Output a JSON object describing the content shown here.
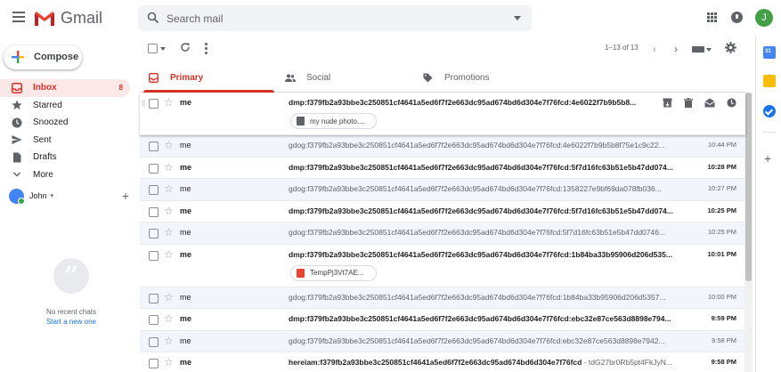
{
  "app": {
    "name": "Gmail",
    "user_initial": "J"
  },
  "search": {
    "placeholder": "Search mail"
  },
  "compose": {
    "label": "Compose"
  },
  "nav": [
    {
      "label": "Inbox",
      "count": "8",
      "icon": "inbox-icon"
    },
    {
      "label": "Starred",
      "count": "",
      "icon": "star-icon"
    },
    {
      "label": "Snoozed",
      "count": "",
      "icon": "clock-icon"
    },
    {
      "label": "Sent",
      "count": "",
      "icon": "send-icon"
    },
    {
      "label": "Drafts",
      "count": "",
      "icon": "draft-icon"
    },
    {
      "label": "More",
      "count": "",
      "icon": "chevron-down-icon"
    }
  ],
  "hangouts": {
    "user": "John",
    "empty_text": "No recent chats",
    "start_link": "Start a new one"
  },
  "toolbar": {
    "pager": "1–13 of 13"
  },
  "tabs": [
    {
      "label": "Primary",
      "icon": "inbox-icon"
    },
    {
      "label": "Social",
      "icon": "people-icon"
    },
    {
      "label": "Promotions",
      "icon": "tag-icon"
    }
  ],
  "emails": [
    {
      "sender": "me",
      "subject": "dmp:f379fb2a93bbe3c250851cf4641a5ed6f7f2e663dc95ad674bd6d304e7f76fcd:4e6022f7b9b5b8...",
      "snippet": "",
      "time": "",
      "attachment": "my nude photo....",
      "unread": true
    },
    {
      "sender": "me",
      "subject": "gdog:f379fb2a93bbe3c250851cf4641a5ed6f7f2e663dc95ad674bd6d304e7f76fcd:4e6022f7b9b5b8f75e1c9c22...",
      "snippet": "",
      "time": "10:44 PM",
      "attachment": "",
      "unread": false
    },
    {
      "sender": "me",
      "subject": "dmp:f379fb2a93bbe3c250851cf4641a5ed6f7f2e663dc95ad674bd6d304e7f76fcd:5f7d16fc63b51e5b47dd074...",
      "snippet": "",
      "time": "10:28 PM",
      "attachment": "",
      "unread": true
    },
    {
      "sender": "me",
      "subject": "gdog:f379fb2a93bbe3c250851cf4641a5ed6f7f2e663dc95ad674bd6d304e7f76fcd:1358227e9bf69da078fb036...",
      "snippet": "",
      "time": "10:27 PM",
      "attachment": "",
      "unread": false
    },
    {
      "sender": "me",
      "subject": "dmp:f379fb2a93bbe3c250851cf4641a5ed6f7f2e663dc95ad674bd6d304e7f76fcd:5f7d16fc63b51e5b47dd074...",
      "snippet": "",
      "time": "10:25 PM",
      "attachment": "",
      "unread": true
    },
    {
      "sender": "me",
      "subject": "gdog:f379fb2a93bbe3c250851cf4641a5ed6f7f2e663dc95ad674bd6d304e7f76fcd:5f7d16fc63b51e5b47dd0746...",
      "snippet": "",
      "time": "10:25 PM",
      "attachment": "",
      "unread": false
    },
    {
      "sender": "me",
      "subject": "dmp:f379fb2a93bbe3c250851cf4641a5ed6f7f2e663dc95ad674bd6d304e7f76fcd:1b84ba33b95906d206d535...",
      "snippet": "",
      "time": "10:01 PM",
      "attachment": "TempPj3Vt7AE...",
      "unread": true
    },
    {
      "sender": "me",
      "subject": "gdog:f379fb2a93bbe3c250851cf4641a5ed6f7f2e663dc95ad674bd6d304e7f76fcd:1b84ba33b95906d206d5357...",
      "snippet": "",
      "time": "10:00 PM",
      "attachment": "",
      "unread": false
    },
    {
      "sender": "me",
      "subject": "dmp:f379fb2a93bbe3c250851cf4641a5ed6f7f2e663dc95ad674bd6d304e7f76fcd:ebc32e87ce563d8898e794...",
      "snippet": "",
      "time": "9:59 PM",
      "attachment": "",
      "unread": true
    },
    {
      "sender": "me",
      "subject": "gdog:f379fb2a93bbe3c250851cf4641a5ed6f7f2e663dc95ad674bd6d304e7f76fcd:ebc32e87ce563d8898e7942...",
      "snippet": "",
      "time": "9:58 PM",
      "attachment": "",
      "unread": false
    },
    {
      "sender": "me",
      "subject": "hereiam:f379fb2a93bbe3c250851cf4641a5ed6f7f2e663dc95ad674bd6d304e7f76fcd",
      "snippet": " - tdG27br0Rb5pt4FkJyN...",
      "time": "9:58 PM",
      "attachment": "",
      "unread": true
    }
  ],
  "colors": {
    "accent_red": "#d93025",
    "inbox_bg": "#fce8e6",
    "read_row_bg": "#f2f6fc"
  }
}
